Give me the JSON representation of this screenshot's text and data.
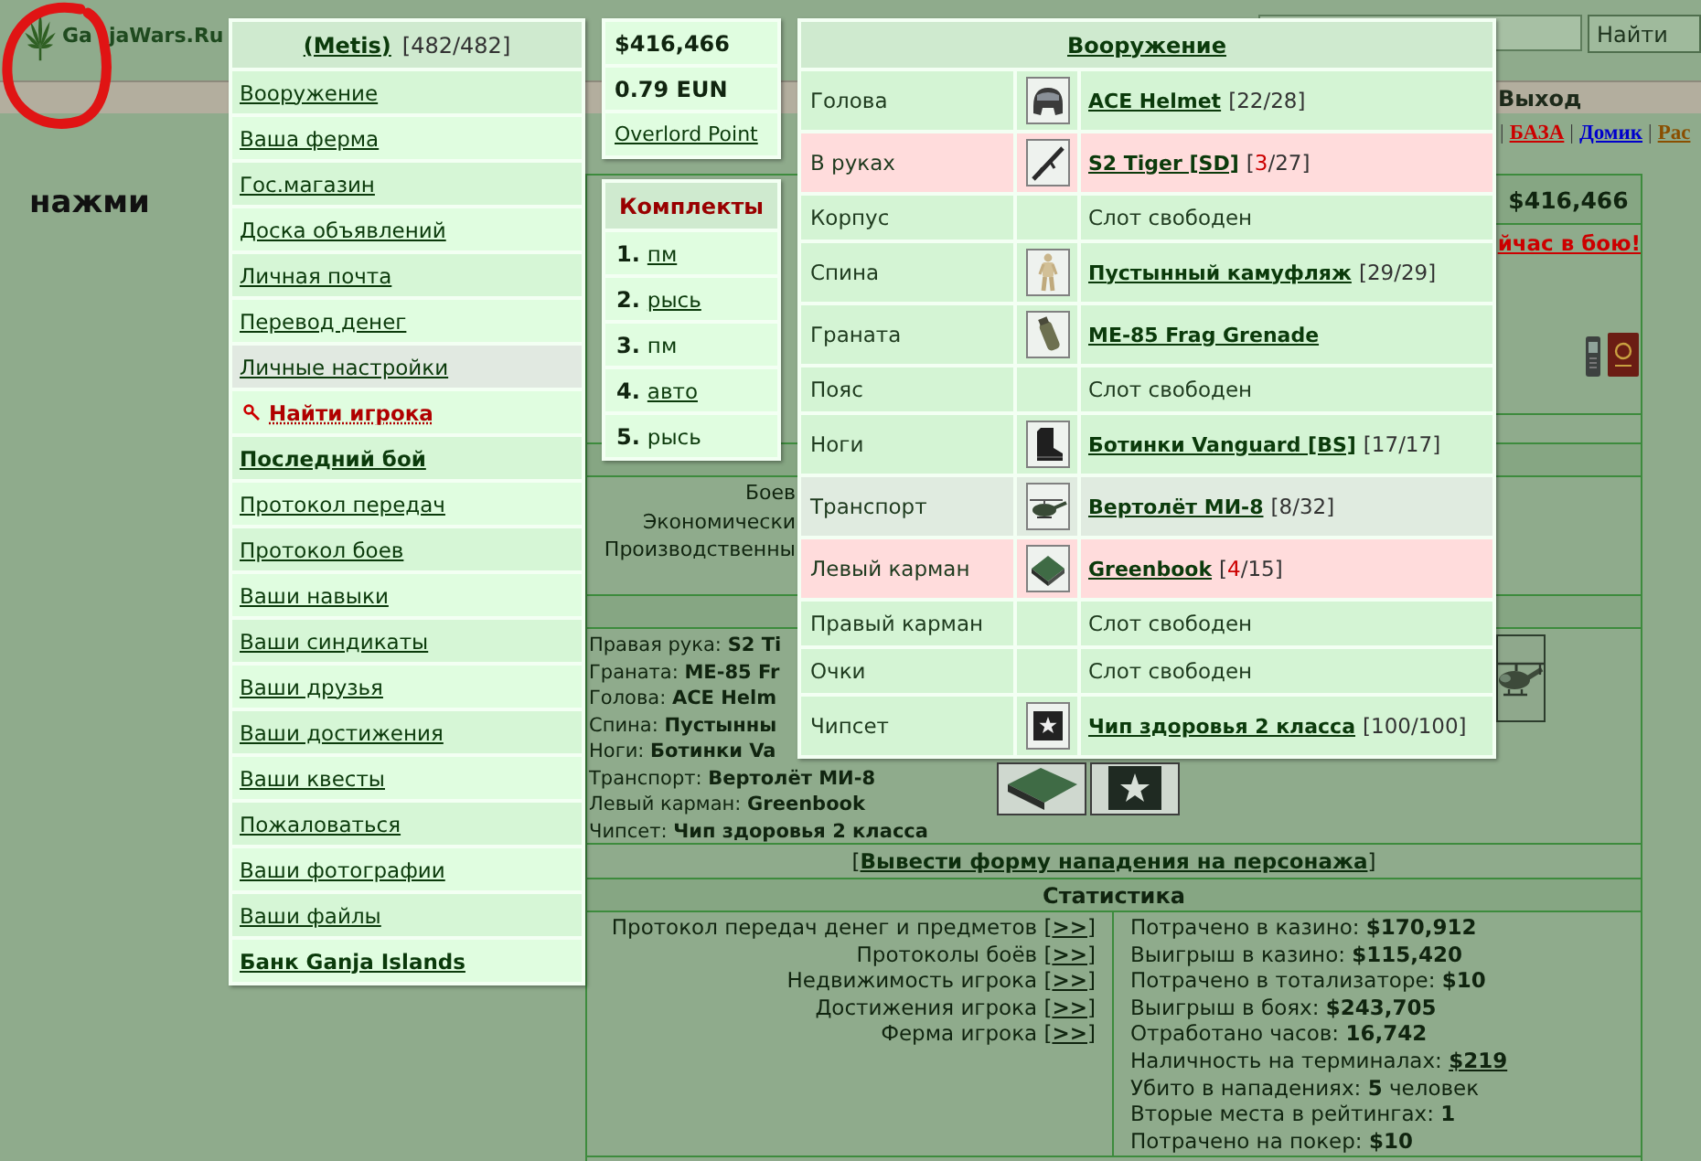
{
  "header": {
    "logo_parts": [
      "Ga",
      "jaWars.Ru"
    ],
    "search_button": "Найти"
  },
  "menu_bar": {
    "logout": "Выход"
  },
  "nav_links": [
    {
      "separator": "|",
      "text": "БАЗА",
      "color": "#cc0000"
    },
    {
      "separator": "|",
      "text": "Домик",
      "color": "#0000cc"
    },
    {
      "separator": "|",
      "text": "Рас",
      "color": "#8a4f00"
    }
  ],
  "hint": "нажми",
  "user_menu": {
    "player": "(Metis)",
    "health": "[482/482]",
    "items": [
      {
        "label": "Вооружение",
        "kind": "link",
        "highlighted": false
      },
      {
        "label": "Ваша ферма",
        "kind": "link",
        "highlighted": false
      },
      {
        "label": "Гос.магазин",
        "kind": "link",
        "highlighted": false
      },
      {
        "label": "Доска объявлений",
        "kind": "link",
        "highlighted": false
      },
      {
        "label": "Личная почта",
        "kind": "link",
        "highlighted": false
      },
      {
        "label": "Перевод денег",
        "kind": "link",
        "highlighted": false
      },
      {
        "label": "Личные настройки",
        "kind": "link",
        "highlighted": true
      },
      {
        "label": "Найти игрока",
        "kind": "find",
        "highlighted": false
      },
      {
        "label": "Последний бой",
        "kind": "bold",
        "highlighted": false
      },
      {
        "label": "Протокол передач",
        "kind": "link",
        "highlighted": false
      },
      {
        "label": "Протокол боев",
        "kind": "link",
        "highlighted": false
      },
      {
        "label": "Ваши навыки",
        "kind": "link",
        "highlighted": false
      },
      {
        "label": "Ваши синдикаты",
        "kind": "link",
        "highlighted": false
      },
      {
        "label": "Ваши друзья",
        "kind": "link",
        "highlighted": false
      },
      {
        "label": "Ваши достижения",
        "kind": "link",
        "highlighted": false
      },
      {
        "label": "Ваши квесты",
        "kind": "link",
        "highlighted": false
      },
      {
        "label": "Пожаловаться",
        "kind": "link",
        "highlighted": false
      },
      {
        "label": "Ваши фотографии",
        "kind": "link",
        "highlighted": false
      },
      {
        "label": "Ваши файлы",
        "kind": "link",
        "highlighted": false
      },
      {
        "label": "Банк Ganja Islands",
        "kind": "bold",
        "highlighted": false
      }
    ]
  },
  "wallet": [
    {
      "text": "$416,466",
      "kind": "amount"
    },
    {
      "text": "0.79 EUN",
      "kind": "amount"
    },
    {
      "text": "Overlord Point",
      "kind": "link"
    }
  ],
  "kits": {
    "title": "Комплекты",
    "items": [
      {
        "number": "1.",
        "name": "пм",
        "linked": true
      },
      {
        "number": "2.",
        "name": "рысь",
        "linked": true
      },
      {
        "number": "3.",
        "name": "пм",
        "linked": false
      },
      {
        "number": "4.",
        "name": "авто",
        "linked": true
      },
      {
        "number": "5.",
        "name": "рысь",
        "linked": false
      }
    ]
  },
  "armory": {
    "title": "Вооружение",
    "slots": [
      {
        "slot": "Голова",
        "kind": "helmet",
        "item": "ACE Helmet",
        "durability": [
          "[",
          "22",
          "/28]"
        ],
        "worn": false,
        "highlighted": false
      },
      {
        "slot": "В руках",
        "kind": "rifle",
        "item": "S2 Tiger [SD]",
        "durability": [
          "[",
          "3",
          "/27]"
        ],
        "worn": true,
        "highlighted": false
      },
      {
        "slot": "Корпус",
        "kind": "empty",
        "item": "Слот свободен",
        "worn": false,
        "highlighted": false
      },
      {
        "slot": "Спина",
        "kind": "camo",
        "item": "Пустынный камуфляж",
        "durability": [
          "[",
          "29",
          "/29]"
        ],
        "worn": false,
        "highlighted": false
      },
      {
        "slot": "Граната",
        "kind": "grenade",
        "item": "ME-85 Frag Grenade",
        "worn": false,
        "highlighted": false
      },
      {
        "slot": "Пояс",
        "kind": "empty",
        "item": "Слот свободен",
        "worn": false,
        "highlighted": false
      },
      {
        "slot": "Ноги",
        "kind": "boots",
        "item": "Ботинки Vanguard [BS]",
        "durability": [
          "[",
          "17",
          "/17]"
        ],
        "worn": false,
        "highlighted": false
      },
      {
        "slot": "Транспорт",
        "kind": "helicopter",
        "item": "Вертолёт МИ-8",
        "durability": [
          "[",
          "8",
          "/32]"
        ],
        "worn": false,
        "highlighted": true
      },
      {
        "slot": "Левый карман",
        "kind": "book",
        "item": "Greenbook",
        "durability": [
          "[",
          "4",
          "/15]"
        ],
        "worn": true,
        "highlighted": false
      },
      {
        "slot": "Правый карман",
        "kind": "empty",
        "item": "Слот свободен",
        "worn": false,
        "highlighted": false
      },
      {
        "slot": "Очки",
        "kind": "empty",
        "item": "Слот свободен",
        "worn": false,
        "highlighted": false
      },
      {
        "slot": "Чипсет",
        "kind": "chip",
        "item": "Чип здоровья 2 класса",
        "durability": [
          "[",
          "100",
          "/100]"
        ],
        "worn": false,
        "highlighted": false
      }
    ]
  },
  "profile": {
    "balance": "$416,466",
    "status": "йчас в бою!",
    "stat_labels": [
      "Боев",
      "Экономически",
      "Производственны"
    ],
    "equipment": [
      {
        "label": "Правая рука:",
        "value": "S2 Ti"
      },
      {
        "label": "Граната:",
        "value": "ME-85 Fr"
      },
      {
        "label": "Голова:",
        "value": "ACE Helm"
      },
      {
        "label": "Спина:",
        "value": "Пустынны"
      },
      {
        "label": "Ноги:",
        "value": "Ботинки Va"
      },
      {
        "label": "Транспорт:",
        "value": "Вертолёт МИ-8"
      },
      {
        "label": "Левый карман:",
        "value": "Greenbook"
      },
      {
        "label": "Чипсет:",
        "value": "Чип здоровья 2 класса"
      }
    ],
    "attack": [
      "[",
      "Вывести форму нападения на персонажа",
      "]"
    ]
  },
  "statistics": {
    "title": "Статистика",
    "protocols": [
      {
        "label": "Протокол передач денег и предметов",
        "link": [
          "[",
          ">>",
          "]"
        ]
      },
      {
        "label": "Протоколы боёв",
        "link": [
          "[",
          ">>",
          "]"
        ]
      },
      {
        "label": "Недвижимость игрока",
        "link": [
          "[",
          ">>",
          "]"
        ]
      },
      {
        "label": "Достижения игрока",
        "link": [
          "[",
          ">>",
          "]"
        ]
      },
      {
        "label": "Ферма игрока",
        "link": [
          "[",
          ">>",
          "]"
        ]
      }
    ],
    "totals": [
      {
        "label": "Потрачено в казино:",
        "value": "$170,912",
        "linked": false
      },
      {
        "label": "Выигрыш в казино:",
        "value": "$115,420",
        "linked": false
      },
      {
        "label": "Потрачено в тотализаторе:",
        "value": "$10",
        "linked": false
      },
      {
        "label": "Выигрыш в боях:",
        "value": "$243,705",
        "linked": false
      },
      {
        "label": "Отработано часов:",
        "value": "16,742",
        "linked": false
      },
      {
        "label": "Наличность на терминалах:",
        "value": "$219",
        "linked": true
      },
      {
        "label": "Убито в нападениях:",
        "value": "5",
        "suffix": "человек",
        "linked": false
      },
      {
        "label": "Вторые места в рейтингах:",
        "value": "1",
        "linked": false
      },
      {
        "label": "Потрачено на покер:",
        "value": "$10",
        "linked": false
      }
    ]
  }
}
